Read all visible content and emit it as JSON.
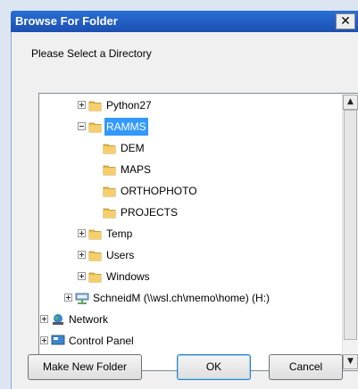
{
  "dialog": {
    "title": "Browse For Folder",
    "close_label": "✕",
    "prompt": "Please Select a Directory"
  },
  "tree": {
    "items": [
      {
        "label": "Python27",
        "expander": "plus",
        "icon": "folder-icon",
        "selected": false
      },
      {
        "label": "RAMMS",
        "expander": "minus",
        "icon": "folder-icon",
        "selected": true
      },
      {
        "label": "DEM",
        "expander": "none",
        "icon": "folder-icon",
        "selected": false
      },
      {
        "label": "MAPS",
        "expander": "none",
        "icon": "folder-icon",
        "selected": false
      },
      {
        "label": "ORTHOPHOTO",
        "expander": "none",
        "icon": "folder-icon",
        "selected": false
      },
      {
        "label": "PROJECTS",
        "expander": "none",
        "icon": "folder-icon",
        "selected": false
      },
      {
        "label": "Temp",
        "expander": "plus",
        "icon": "folder-icon",
        "selected": false
      },
      {
        "label": "Users",
        "expander": "plus",
        "icon": "folder-icon",
        "selected": false
      },
      {
        "label": "Windows",
        "expander": "plus",
        "icon": "folder-icon",
        "selected": false
      },
      {
        "label": "SchneidM (\\\\wsl.ch\\memo\\home) (H:)",
        "expander": "plus",
        "icon": "network-drive-icon",
        "selected": false
      },
      {
        "label": "Network",
        "expander": "plus",
        "icon": "network-icon",
        "selected": false
      },
      {
        "label": "Control Panel",
        "expander": "plus",
        "icon": "control-panel-icon",
        "selected": false
      }
    ]
  },
  "buttons": {
    "new_folder": "Make New Folder",
    "ok": "OK",
    "cancel": "Cancel"
  },
  "colors": {
    "selection": "#3399ff",
    "titlebar": "#1c4fb0",
    "folder": "#e8b84a"
  }
}
